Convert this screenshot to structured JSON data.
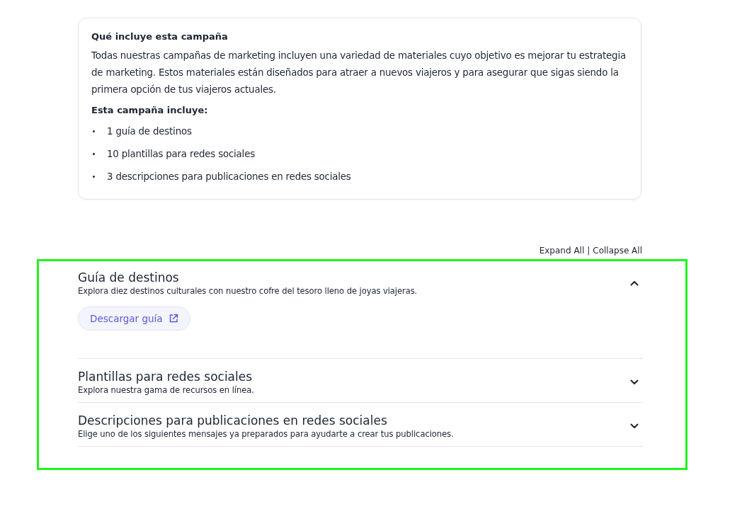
{
  "summary": {
    "title": "Qué incluye esta campaña",
    "description": "Todas nuestras campañas de marketing incluyen una variedad de materiales cuyo objetivo es mejorar tu estrategia de marketing. Estos materiales están diseñados para atraer a nuevos viajeros y para asegurar que sigas siendo la primera opción de tus viajeros actuales.",
    "includes_heading": "Esta campaña incluye:",
    "items": [
      "1 guía de destinos",
      "10 plantillas para redes sociales",
      "3 descripciones para publicaciones en redes sociales"
    ]
  },
  "accordion_controls": {
    "expand": "Expand All",
    "separator": "|",
    "collapse": "Collapse All"
  },
  "sections": [
    {
      "title": "Guía de destinos",
      "subtitle": "Explora diez destinos culturales con nuestro cofre del tesoro lleno de joyas viajeras.",
      "expanded": true,
      "action": "Descargar guía"
    },
    {
      "title": "Plantillas para redes sociales",
      "subtitle": "Explora nuestra gama de recursos en línea.",
      "expanded": false
    },
    {
      "title": "Descripciones para publicaciones en redes sociales",
      "subtitle": "Elige uno de los siguientes mensajes ya preparados para ayudarte a crear tus publicaciones.",
      "expanded": false
    }
  ]
}
